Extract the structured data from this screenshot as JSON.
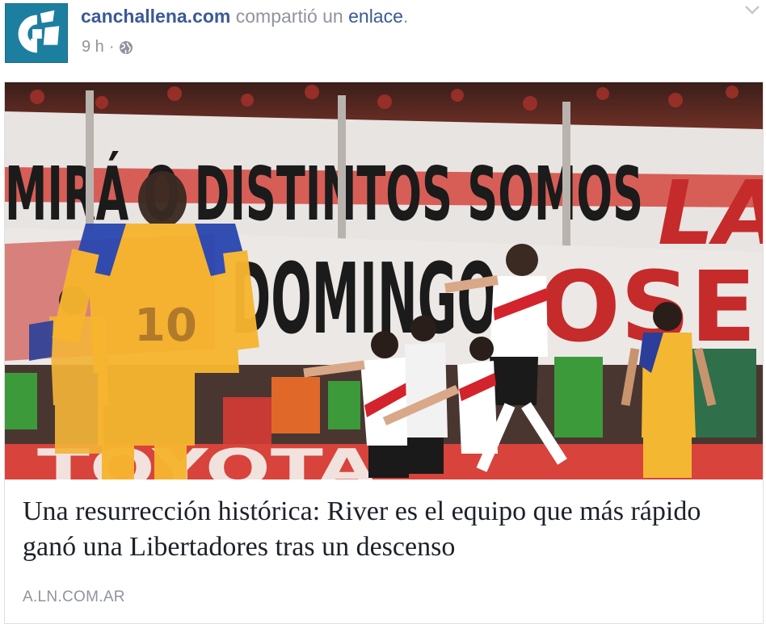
{
  "post": {
    "page_name": "canchallena.com",
    "action_text": "compartió un",
    "action_link": "enlace",
    "action_period": ".",
    "timestamp": "9 h",
    "separator": "·",
    "privacy_icon": "globe-icon",
    "menu_icon": "chevron-down-icon"
  },
  "avatar": {
    "icon": "canchallena-logo",
    "brand_color": "#1d7fa0"
  },
  "link_preview": {
    "image_subject": "River Plate players celebrating a goal against Tigres",
    "banner_text_top": "MIRÁ O DISTINTOS SOMOS",
    "banner_text_right": "LA",
    "banner_text_middle": "DOMINGO",
    "banner_text_right2": "OSE",
    "board_text": "TOYOTA",
    "player_number": "10",
    "title": "Una resurrección histórica: River es el equipo que más rápido ganó una Libertadores tras un descenso",
    "domain": "A.LN.COM.AR"
  },
  "colors": {
    "link_blue": "#3b5998",
    "meta_gray": "#90949c",
    "title_text": "#1d2129",
    "tigres_yellow": "#f4b731",
    "river_red": "#d3232c"
  }
}
